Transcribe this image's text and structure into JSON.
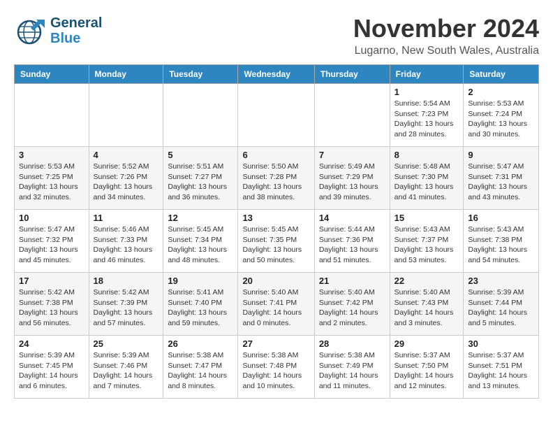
{
  "header": {
    "logo_general": "General",
    "logo_blue": "Blue",
    "month": "November 2024",
    "location": "Lugarno, New South Wales, Australia"
  },
  "weekdays": [
    "Sunday",
    "Monday",
    "Tuesday",
    "Wednesday",
    "Thursday",
    "Friday",
    "Saturday"
  ],
  "weeks": [
    [
      {
        "day": "",
        "info": ""
      },
      {
        "day": "",
        "info": ""
      },
      {
        "day": "",
        "info": ""
      },
      {
        "day": "",
        "info": ""
      },
      {
        "day": "",
        "info": ""
      },
      {
        "day": "1",
        "info": "Sunrise: 5:54 AM\nSunset: 7:23 PM\nDaylight: 13 hours\nand 28 minutes."
      },
      {
        "day": "2",
        "info": "Sunrise: 5:53 AM\nSunset: 7:24 PM\nDaylight: 13 hours\nand 30 minutes."
      }
    ],
    [
      {
        "day": "3",
        "info": "Sunrise: 5:53 AM\nSunset: 7:25 PM\nDaylight: 13 hours\nand 32 minutes."
      },
      {
        "day": "4",
        "info": "Sunrise: 5:52 AM\nSunset: 7:26 PM\nDaylight: 13 hours\nand 34 minutes."
      },
      {
        "day": "5",
        "info": "Sunrise: 5:51 AM\nSunset: 7:27 PM\nDaylight: 13 hours\nand 36 minutes."
      },
      {
        "day": "6",
        "info": "Sunrise: 5:50 AM\nSunset: 7:28 PM\nDaylight: 13 hours\nand 38 minutes."
      },
      {
        "day": "7",
        "info": "Sunrise: 5:49 AM\nSunset: 7:29 PM\nDaylight: 13 hours\nand 39 minutes."
      },
      {
        "day": "8",
        "info": "Sunrise: 5:48 AM\nSunset: 7:30 PM\nDaylight: 13 hours\nand 41 minutes."
      },
      {
        "day": "9",
        "info": "Sunrise: 5:47 AM\nSunset: 7:31 PM\nDaylight: 13 hours\nand 43 minutes."
      }
    ],
    [
      {
        "day": "10",
        "info": "Sunrise: 5:47 AM\nSunset: 7:32 PM\nDaylight: 13 hours\nand 45 minutes."
      },
      {
        "day": "11",
        "info": "Sunrise: 5:46 AM\nSunset: 7:33 PM\nDaylight: 13 hours\nand 46 minutes."
      },
      {
        "day": "12",
        "info": "Sunrise: 5:45 AM\nSunset: 7:34 PM\nDaylight: 13 hours\nand 48 minutes."
      },
      {
        "day": "13",
        "info": "Sunrise: 5:45 AM\nSunset: 7:35 PM\nDaylight: 13 hours\nand 50 minutes."
      },
      {
        "day": "14",
        "info": "Sunrise: 5:44 AM\nSunset: 7:36 PM\nDaylight: 13 hours\nand 51 minutes."
      },
      {
        "day": "15",
        "info": "Sunrise: 5:43 AM\nSunset: 7:37 PM\nDaylight: 13 hours\nand 53 minutes."
      },
      {
        "day": "16",
        "info": "Sunrise: 5:43 AM\nSunset: 7:38 PM\nDaylight: 13 hours\nand 54 minutes."
      }
    ],
    [
      {
        "day": "17",
        "info": "Sunrise: 5:42 AM\nSunset: 7:38 PM\nDaylight: 13 hours\nand 56 minutes."
      },
      {
        "day": "18",
        "info": "Sunrise: 5:42 AM\nSunset: 7:39 PM\nDaylight: 13 hours\nand 57 minutes."
      },
      {
        "day": "19",
        "info": "Sunrise: 5:41 AM\nSunset: 7:40 PM\nDaylight: 13 hours\nand 59 minutes."
      },
      {
        "day": "20",
        "info": "Sunrise: 5:40 AM\nSunset: 7:41 PM\nDaylight: 14 hours\nand 0 minutes."
      },
      {
        "day": "21",
        "info": "Sunrise: 5:40 AM\nSunset: 7:42 PM\nDaylight: 14 hours\nand 2 minutes."
      },
      {
        "day": "22",
        "info": "Sunrise: 5:40 AM\nSunset: 7:43 PM\nDaylight: 14 hours\nand 3 minutes."
      },
      {
        "day": "23",
        "info": "Sunrise: 5:39 AM\nSunset: 7:44 PM\nDaylight: 14 hours\nand 5 minutes."
      }
    ],
    [
      {
        "day": "24",
        "info": "Sunrise: 5:39 AM\nSunset: 7:45 PM\nDaylight: 14 hours\nand 6 minutes."
      },
      {
        "day": "25",
        "info": "Sunrise: 5:39 AM\nSunset: 7:46 PM\nDaylight: 14 hours\nand 7 minutes."
      },
      {
        "day": "26",
        "info": "Sunrise: 5:38 AM\nSunset: 7:47 PM\nDaylight: 14 hours\nand 8 minutes."
      },
      {
        "day": "27",
        "info": "Sunrise: 5:38 AM\nSunset: 7:48 PM\nDaylight: 14 hours\nand 10 minutes."
      },
      {
        "day": "28",
        "info": "Sunrise: 5:38 AM\nSunset: 7:49 PM\nDaylight: 14 hours\nand 11 minutes."
      },
      {
        "day": "29",
        "info": "Sunrise: 5:37 AM\nSunset: 7:50 PM\nDaylight: 14 hours\nand 12 minutes."
      },
      {
        "day": "30",
        "info": "Sunrise: 5:37 AM\nSunset: 7:51 PM\nDaylight: 14 hours\nand 13 minutes."
      }
    ]
  ]
}
